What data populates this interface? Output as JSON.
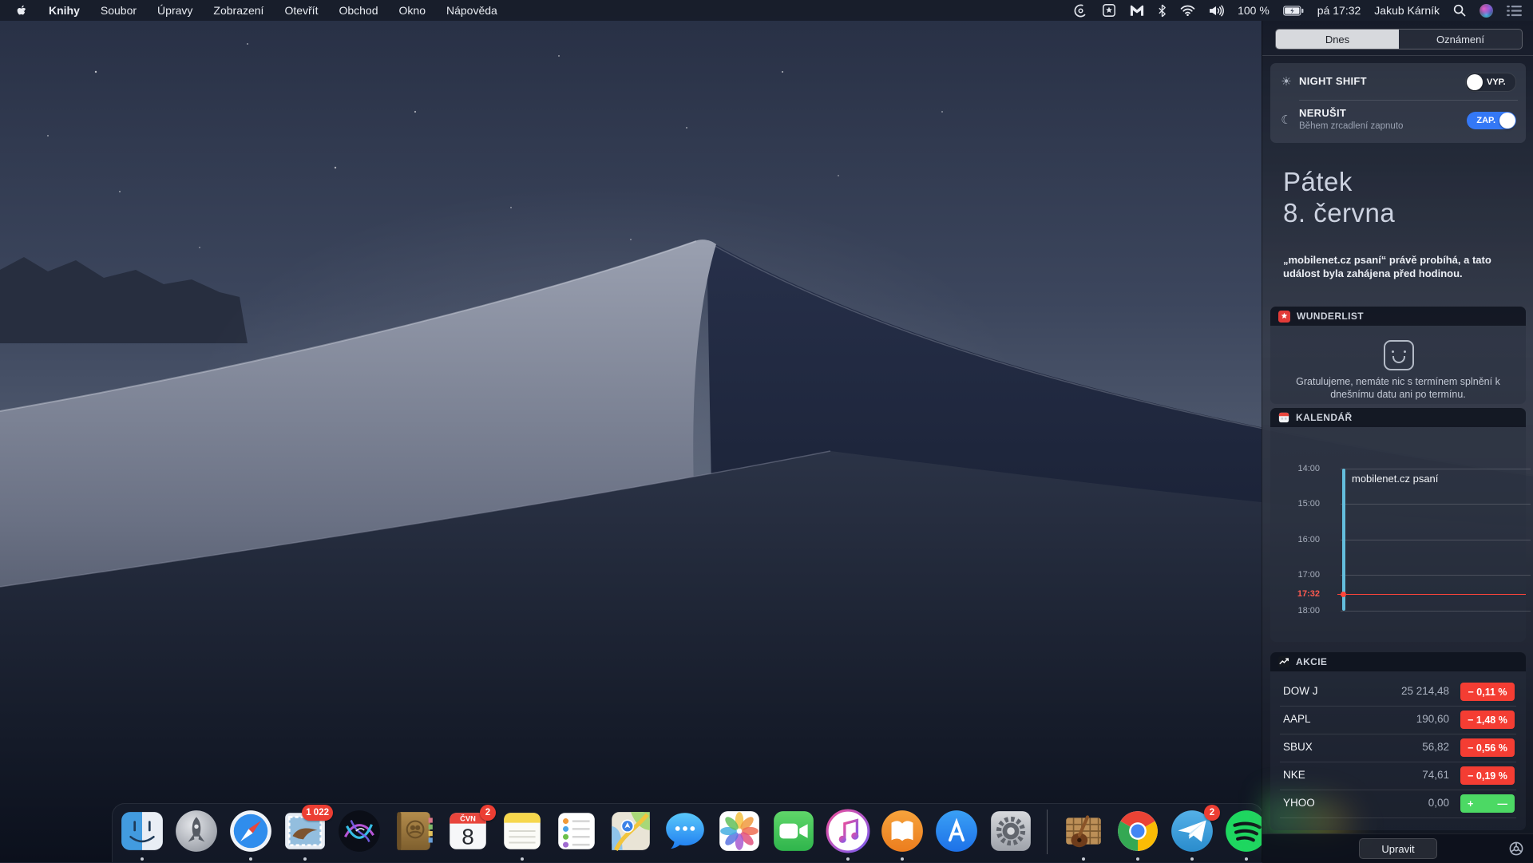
{
  "menu_bar": {
    "app_name": "Knihy",
    "menus": [
      "Soubor",
      "Úpravy",
      "Zobrazení",
      "Otevřít",
      "Obchod",
      "Okno",
      "Nápověda"
    ],
    "status": {
      "battery": "100 %",
      "clock": "pá 17:32",
      "user": "Jakub Kárník"
    },
    "status_icons": [
      "adobe-creative-cloud",
      "password-manager",
      "malwarebytes",
      "bluetooth",
      "wifi",
      "volume"
    ]
  },
  "notification_center": {
    "tabs": [
      {
        "label": "Dnes",
        "selected": true
      },
      {
        "label": "Oznámení",
        "selected": false
      }
    ],
    "night_shift": {
      "label": "NIGHT SHIFT",
      "state": "VYP.",
      "on": false
    },
    "do_not_disturb": {
      "label": "NERUŠIT",
      "sublabel": "Během zrcadlení zapnuto",
      "state": "ZAP.",
      "on": true
    },
    "date": {
      "weekday": "Pátek",
      "day": "8. června"
    },
    "event_note": "„mobilenet.cz psaní“ právě probíhá, a tato událost byla zahájena před hodinou.",
    "wunderlist": {
      "title": "WUNDERLIST",
      "message": "Gratulujeme, nemáte nic s termínem splnění k dnešnímu datu ani po termínu."
    },
    "calendar": {
      "title": "KALENDÁŘ",
      "times": [
        "14:00",
        "15:00",
        "16:00",
        "17:00",
        "18:00"
      ],
      "now": "17:32",
      "event": "mobilenet.cz psaní"
    },
    "stocks": {
      "title": "AKCIE",
      "rows": [
        {
          "symbol": "DOW J",
          "value": "25 214,48",
          "change": "− 0,11 %",
          "direction": "down"
        },
        {
          "symbol": "AAPL",
          "value": "190,60",
          "change": "− 1,48 %",
          "direction": "down"
        },
        {
          "symbol": "SBUX",
          "value": "56,82",
          "change": "− 0,56 %",
          "direction": "down"
        },
        {
          "symbol": "NKE",
          "value": "74,61",
          "change": "− 0,19 %",
          "direction": "down"
        },
        {
          "symbol": "YHOO",
          "value": "0,00",
          "change": "+ —",
          "direction": "flat"
        }
      ]
    },
    "footer": {
      "edit": "Upravit"
    }
  },
  "dock": {
    "items": [
      {
        "name": "finder",
        "running": true
      },
      {
        "name": "launchpad",
        "running": false
      },
      {
        "name": "safari",
        "running": true
      },
      {
        "name": "mail",
        "running": true,
        "badge": "1 022"
      },
      {
        "name": "siri",
        "running": false
      },
      {
        "name": "contacts",
        "running": false
      },
      {
        "name": "calendar",
        "running": false,
        "badge": "2",
        "month": "ČVN",
        "day": "8"
      },
      {
        "name": "notes",
        "running": true
      },
      {
        "name": "reminders",
        "running": false
      },
      {
        "name": "maps",
        "running": false
      },
      {
        "name": "messages",
        "running": false
      },
      {
        "name": "photos",
        "running": false
      },
      {
        "name": "facetime",
        "running": false
      },
      {
        "name": "itunes",
        "running": true
      },
      {
        "name": "books",
        "running": true
      },
      {
        "name": "app-store",
        "running": false
      },
      {
        "name": "system-preferences",
        "running": false
      },
      {
        "name": "divider"
      },
      {
        "name": "garageband",
        "running": true
      },
      {
        "name": "chrome",
        "running": true
      },
      {
        "name": "telegram",
        "running": true,
        "badge": "2"
      },
      {
        "name": "spotify",
        "running": true
      }
    ]
  },
  "colors": {
    "accent_blue": "#3478f6",
    "stock_down": "#f43d33",
    "stock_flat": "#4cd964",
    "now_red": "#ff453a",
    "event_cyan": "#63bddc"
  }
}
